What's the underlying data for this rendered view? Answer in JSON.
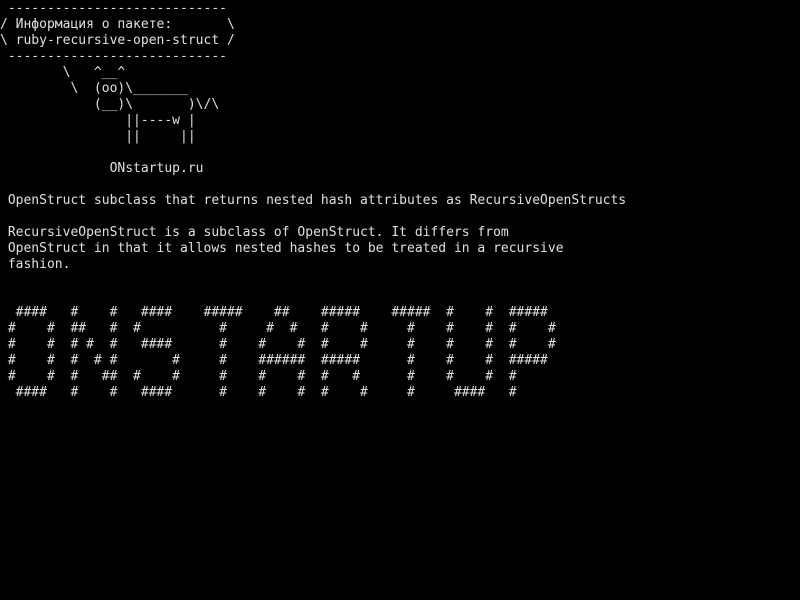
{
  "terminal": {
    "background_color": "#000000",
    "text_color": "#e0e0e0",
    "cowsay_lines": [
      " ----------------------------",
      "/ Информация о пакете:       \\",
      "\\ ruby-recursive-open-struct /",
      " ----------------------------",
      "        \\   ^__^",
      "         \\  (oo)\\_______",
      "            (__)\\       )\\/\\",
      "                ||----w |",
      "                ||     ||"
    ],
    "site_line": "              ONstartup.ru",
    "summary_line": " OpenStruct subclass that returns nested hash attributes as RecursiveOpenStructs",
    "description_lines": [
      " RecursiveOpenStruct is a subclass of OpenStruct. It differs from",
      " OpenStruct in that it allows nested hashes to be treated in a recursive",
      " fashion."
    ],
    "banner_lines": [
      "  ####   #    #   ####    #####    ##    #####    #####  #    #  #####",
      " #    #  ##   #  #          #     #  #   #    #     #    #    #  #    #",
      " #    #  # #  #   ####      #    #    #  #    #     #    #    #  #    #",
      " #    #  #  # #       #     #    ######  #####      #    #    #  #####",
      " #    #  #   ##  #    #     #    #    #  #   #      #    #    #  #",
      "  ####   #    #   ####      #    #    #  #    #     #     ####   #"
    ]
  }
}
